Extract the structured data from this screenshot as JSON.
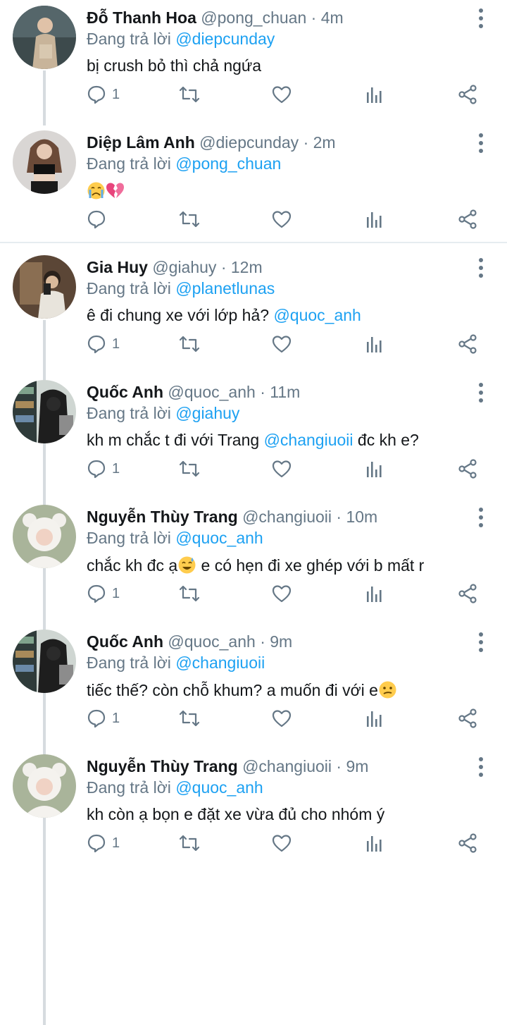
{
  "reply_prefix": "Đang trả lời",
  "tweets": [
    {
      "name": "Đỗ Thanh Hoa",
      "handle": "@pong_chuan",
      "time": "· 4m",
      "reply_to": "@diepcunday",
      "text": "bị crush bỏ thì chả ngứa",
      "text_mention": "",
      "reply_count": "1",
      "emoji": ""
    },
    {
      "name": "Diệp Lâm Anh",
      "handle": "@diepcunday",
      "time": "· 2m",
      "reply_to": "@pong_chuan",
      "text": "",
      "text_mention": "",
      "reply_count": "",
      "emoji": "crying-face broken-heart"
    },
    {
      "name": "Gia Huy",
      "handle": "@giahuy",
      "time": "· 12m",
      "reply_to": "@planetlunas",
      "text": "ê đi chung xe với lớp hả?",
      "text_mention": "@quoc_anh",
      "reply_count": "1",
      "emoji": ""
    },
    {
      "name": "Quốc Anh",
      "handle": "@quoc_anh",
      "time": "· 11m",
      "reply_to": "@giahuy",
      "text": "kh m chắc t đi với Trang",
      "text_mention": "@changiuoii",
      "text_after": "đc kh e?",
      "reply_count": "1",
      "emoji": ""
    },
    {
      "name": "Nguyễn Thùy Trang",
      "handle": "@changiuoii",
      "time": "· 10m",
      "reply_to": "@quoc_anh",
      "text": "chắc kh đc ạ",
      "text_after": "e có hẹn đi xe ghép với b mất r",
      "text_mention": "",
      "reply_count": "1",
      "emoji": "sweat-smile"
    },
    {
      "name": "Quốc Anh",
      "handle": "@quoc_anh",
      "time": "· 9m",
      "reply_to": "@changiuoii",
      "text": "tiếc thế? còn chỗ khum? a muốn đi với e",
      "text_mention": "",
      "reply_count": "1",
      "emoji": "confused-face"
    },
    {
      "name": "Nguyễn Thùy Trang",
      "handle": "@changiuoii",
      "time": "· 9m",
      "reply_to": "@quoc_anh",
      "text": "kh còn ạ bọn e đặt xe vừa đủ cho nhóm ý",
      "text_mention": "",
      "reply_count": "1",
      "emoji": ""
    }
  ],
  "icons": {
    "reply": "reply-bubble-icon",
    "retweet": "retweet-icon",
    "like": "heart-icon",
    "stats": "analytics-icon",
    "share": "share-icon",
    "more": "more-vertical-icon"
  },
  "colors": {
    "mention": "#1da1f2",
    "muted": "#657786",
    "thread_line": "#d6dbdf"
  }
}
